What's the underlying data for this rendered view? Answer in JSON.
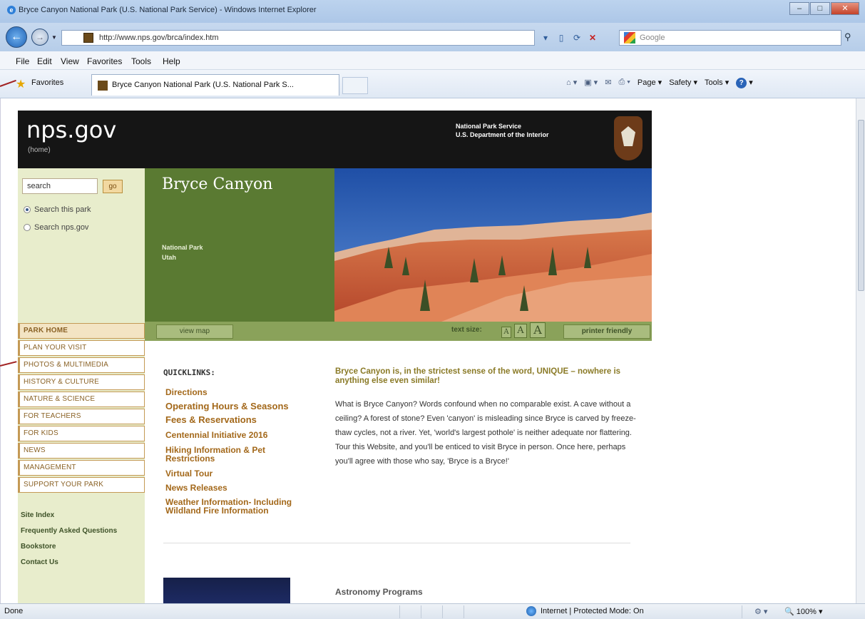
{
  "window": {
    "title": "Bryce Canyon National Park (U.S. National Park Service) - Windows Internet Explorer"
  },
  "address": {
    "url": "http://www.nps.gov/brca/index.htm",
    "search_placeholder": "Google"
  },
  "menu": [
    "File",
    "Edit",
    "View",
    "Favorites",
    "Tools",
    "Help"
  ],
  "favbar": {
    "favorites_label": "Favorites",
    "tab_title": "Bryce Canyon National Park (U.S. National Park S...",
    "commands": [
      "Page",
      "Safety",
      "Tools"
    ]
  },
  "statusbar": {
    "left": "Done",
    "zone": "Internet | Protected Mode: On",
    "zoom": "100%"
  },
  "site": {
    "logo": "nps.gov",
    "home": "(home)",
    "agency_line1": "National Park Service",
    "agency_line2": "U.S. Department of the Interior",
    "search_value": "search",
    "go_label": "go",
    "radio_park": "Search this park",
    "radio_nps": "Search nps.gov",
    "park_name": "Bryce Canyon",
    "park_type": "National Park",
    "park_state": "Utah",
    "view_map": "view map",
    "text_size_label": "text size:",
    "text_sizes": [
      "A",
      "A",
      "A"
    ],
    "printer_friendly": "printer friendly",
    "sidenav": [
      "PARK HOME",
      "PLAN YOUR VISIT",
      "PHOTOS & MULTIMEDIA",
      "HISTORY & CULTURE",
      "NATURE & SCIENCE",
      "FOR TEACHERS",
      "FOR KIDS",
      "NEWS",
      "MANAGEMENT",
      "SUPPORT YOUR PARK"
    ],
    "sublinks": [
      "Site Index",
      "Frequently Asked Questions",
      "Bookstore",
      "Contact Us"
    ],
    "quicklinks_title": "QUICKLINKS:",
    "quicklinks": [
      "Directions",
      "Operating Hours & Seasons",
      "Fees & Reservations",
      "Centennial Initiative 2016",
      "Hiking Information & Pet Restrictions",
      "Virtual Tour",
      "News Releases",
      "Weather Information- Including Wildland Fire Information"
    ],
    "article_head": "Bryce Canyon is, in the strictest sense of the word, UNIQUE – nowhere is anything else even similar!",
    "article_body": "What is Bryce Canyon? Words confound when no comparable exist. A cave without a ceiling? A forest of stone? Even 'canyon' is misleading since Bryce is carved by freeze-thaw cycles, not a river. Yet, 'world's largest pothole' is neither adequate nor flattering. Tour this Website, and you'll be enticed to visit Bryce in person. Once here, perhaps you'll agree with those who say, 'Bryce is a Bryce!'",
    "astronomy": "Astronomy Programs"
  },
  "colors": {
    "header": "#151515",
    "sidebar_bg": "#e8edcc",
    "title_panel": "#5a7a32",
    "link": "#a3681a",
    "nav_border": "#c49a55"
  }
}
